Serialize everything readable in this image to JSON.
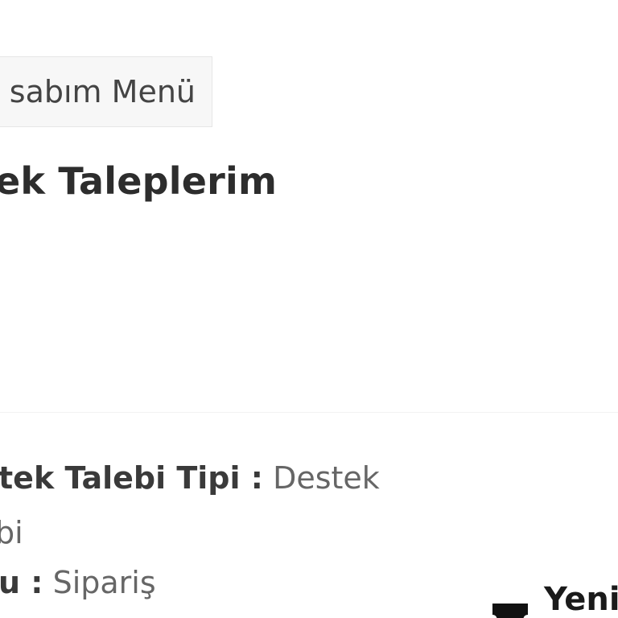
{
  "account_menu": {
    "label": "sabım Menü"
  },
  "page": {
    "title": "ek Taleplerim"
  },
  "ticket": {
    "type_label": "tek Talebi Tipi :",
    "type_value": "Destek",
    "type_value_cont": "bi",
    "subject_label": "u :",
    "subject_value": "Sipariş"
  },
  "actions": {
    "new_request_label": "Yeni",
    "new_request_icon": "ticket-icon"
  }
}
